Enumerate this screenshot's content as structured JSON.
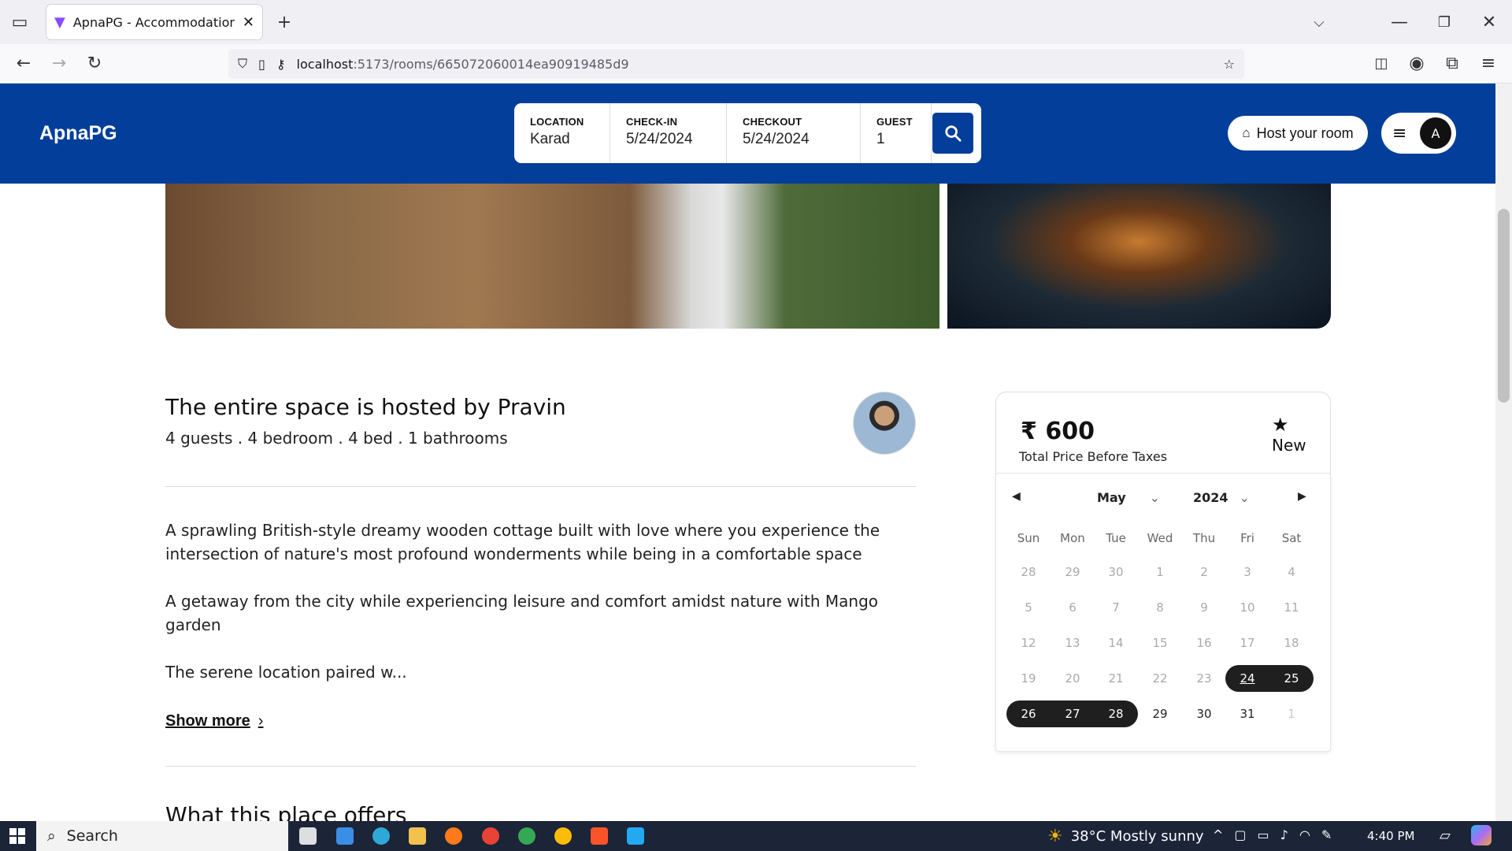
{
  "browser": {
    "tab_title": "ApnaPG - Accommodation Solu",
    "url_host": "localhost",
    "url_rest": ":5173/rooms/665072060014ea90919485d9"
  },
  "header": {
    "logo": "ApnaPG",
    "search": {
      "location_label": "LOCATION",
      "location_value": "Karad",
      "checkin_label": "CHECK-IN",
      "checkin_value": "5/24/2024",
      "checkout_label": "CHECKOUT",
      "checkout_value": "5/24/2024",
      "guest_label": "GUEST",
      "guest_value": "1"
    },
    "host_button": "Host your room",
    "avatar_initial": "A"
  },
  "listing": {
    "hosted_by": "The entire space is hosted by Pravin",
    "details": "4 guests . 4 bedroom . 4 bed . 1 bathrooms",
    "paragraphs": [
      "A sprawling British-style dreamy wooden cottage built with love where you experience the intersection of nature's most profound wonderments while being in a comfortable space",
      "A getaway from the city while experiencing leisure and comfort amidst nature with Mango garden",
      "The serene location paired w..."
    ],
    "show_more": "Show more",
    "offers_heading": "What this place offers"
  },
  "booking": {
    "price": "₹ 600",
    "price_note": "Total Price Before Taxes",
    "rating_label": "New"
  },
  "calendar": {
    "month": "May",
    "year": "2024",
    "weekdays": [
      "Sun",
      "Mon",
      "Tue",
      "Wed",
      "Thu",
      "Fri",
      "Sat"
    ],
    "weeks": [
      [
        "28",
        "29",
        "30",
        "1",
        "2",
        "3",
        "4"
      ],
      [
        "5",
        "6",
        "7",
        "8",
        "9",
        "10",
        "11"
      ],
      [
        "12",
        "13",
        "14",
        "15",
        "16",
        "17",
        "18"
      ],
      [
        "19",
        "20",
        "21",
        "22",
        "23",
        "24",
        "25"
      ],
      [
        "26",
        "27",
        "28",
        "29",
        "30",
        "31",
        "1"
      ]
    ],
    "selected_range": [
      "24",
      "25",
      "26",
      "27",
      "28"
    ],
    "today": "24"
  },
  "taskbar": {
    "search_placeholder": "Search",
    "weather": "38°C  Mostly sunny",
    "time": "4:40 PM"
  },
  "colors": {
    "brand": "#023e9a",
    "selected_day": "#1f1f1f"
  }
}
